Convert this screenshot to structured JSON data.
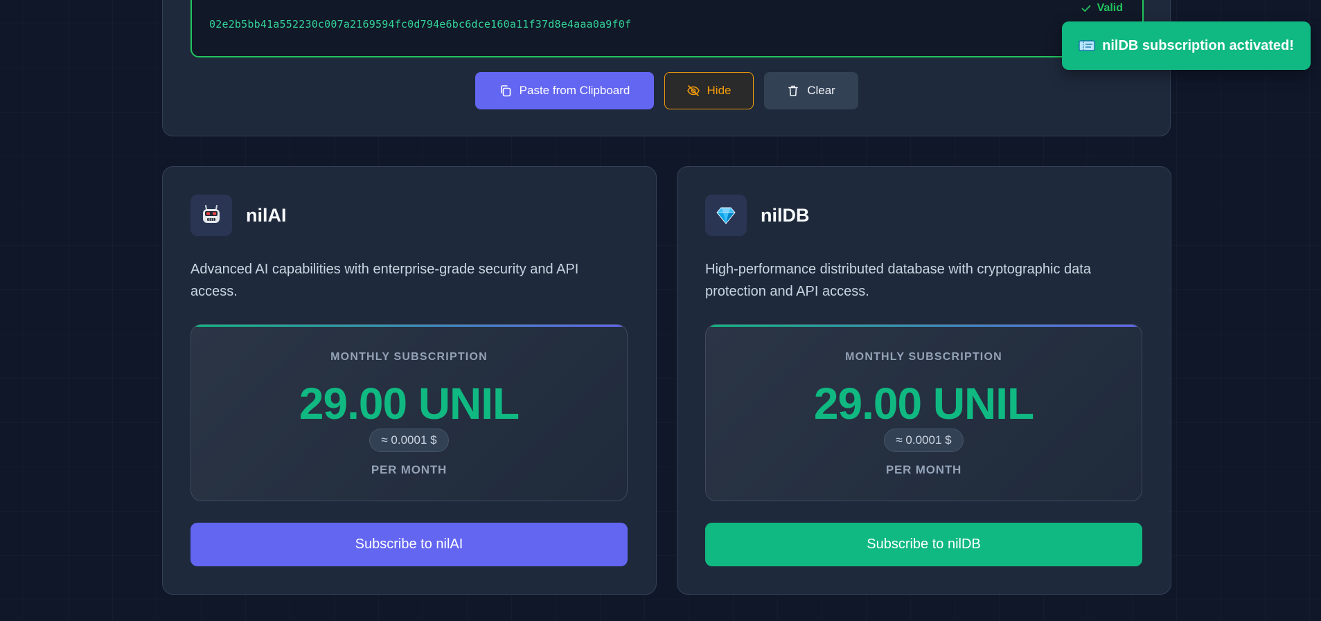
{
  "key_panel": {
    "key_value": "02e2b5bb41a552230c007a2169594fc0d794e6bc6dce160a11f37d8e4aaa0a9f0f",
    "status": "Valid",
    "paste_label": "Paste from Clipboard",
    "hide_label": "Hide",
    "clear_label": "Clear"
  },
  "toast": {
    "message": "nilDB subscription activated!",
    "icon": "ticket-icon"
  },
  "services": [
    {
      "name": "nilAI",
      "icon": "robot-icon",
      "description": "Advanced AI capabilities with enterprise-grade security and API access.",
      "price_label": "MONTHLY SUBSCRIPTION",
      "price": "29.00 UNIL",
      "price_usd": "≈ 0.0001 $",
      "period": "PER MONTH",
      "button_label": "Subscribe to nilAI"
    },
    {
      "name": "nilDB",
      "icon": "diamond-icon",
      "description": "High-performance distributed database with cryptographic data protection and API access.",
      "price_label": "MONTHLY SUBSCRIPTION",
      "price": "29.00 UNIL",
      "price_usd": "≈ 0.0001 $",
      "period": "PER MONTH",
      "button_label": "Subscribe to nilDB"
    }
  ],
  "colors": {
    "background": "#0f1729",
    "card": "#1e293b",
    "accent_purple": "#6366f1",
    "accent_green": "#10b981",
    "valid_green": "#22c55e",
    "warning_amber": "#f59e0b"
  }
}
